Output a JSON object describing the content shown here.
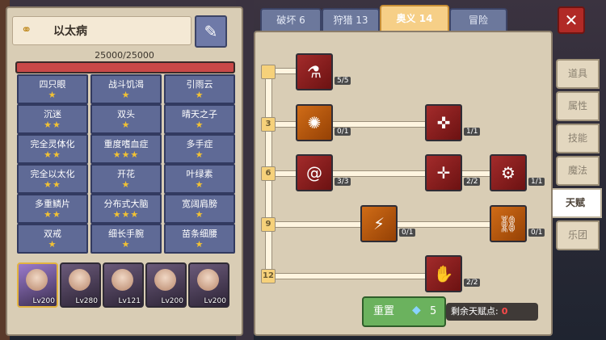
{
  "colors": {
    "accent": "#f6cf87",
    "hp": "#c94848",
    "cell": "#5f6a96"
  },
  "patient": {
    "name": "以太病",
    "icon": "link-chain-icon",
    "hp_text": "25000/25000",
    "hp_fraction": 1.0
  },
  "treatments": [
    {
      "label": "四只眼",
      "stars": "★"
    },
    {
      "label": "战斗饥渴",
      "stars": "★"
    },
    {
      "label": "引雨云",
      "stars": "★"
    },
    {
      "label": "沉迷",
      "stars": "★★"
    },
    {
      "label": "双头",
      "stars": "★"
    },
    {
      "label": "晴天之子",
      "stars": "★"
    },
    {
      "label": "完全灵体化",
      "stars": "★★"
    },
    {
      "label": "重度嗜血症",
      "stars": "★★★"
    },
    {
      "label": "多手症",
      "stars": "★"
    },
    {
      "label": "完全以太化",
      "stars": "★★"
    },
    {
      "label": "开花",
      "stars": "★"
    },
    {
      "label": "叶绿素",
      "stars": "★"
    },
    {
      "label": "多重鳞片",
      "stars": "★★"
    },
    {
      "label": "分布式大脑",
      "stars": "★★★"
    },
    {
      "label": "宽阔肩膀",
      "stars": "★"
    },
    {
      "label": "双戒",
      "stars": "★"
    },
    {
      "label": "细长手腕",
      "stars": "★"
    },
    {
      "label": "苗条细腰",
      "stars": "★"
    }
  ],
  "party": [
    {
      "level": "Lv200",
      "selected": true
    },
    {
      "level": "Lv280",
      "selected": false
    },
    {
      "level": "Lv121",
      "selected": false
    },
    {
      "level": "Lv200",
      "selected": false
    },
    {
      "level": "Lv200",
      "selected": false
    }
  ],
  "tabs": [
    {
      "label": "破坏 6"
    },
    {
      "label": "狩猎 13"
    },
    {
      "label": "奥义 14"
    },
    {
      "label": "冒险"
    }
  ],
  "side_tabs": [
    {
      "label": "道具"
    },
    {
      "label": "属性"
    },
    {
      "label": "技能"
    },
    {
      "label": "魔法"
    },
    {
      "label": "天赋"
    },
    {
      "label": "乐团"
    }
  ],
  "tree": {
    "levels": [
      "3",
      "6",
      "9",
      "12"
    ],
    "skills": [
      {
        "count": "5/5",
        "icon": "mp-icon"
      },
      {
        "count": "0/1",
        "icon": "vortex-icon"
      },
      {
        "count": "1/1",
        "icon": "hand-cross-icon"
      },
      {
        "count": "3/3",
        "icon": "spiral-icon"
      },
      {
        "count": "2/2",
        "icon": "crosshair-icon"
      },
      {
        "count": "1/1",
        "icon": "gear-icon"
      },
      {
        "count": "0/1",
        "icon": "claw-icon"
      },
      {
        "count": "0/1",
        "icon": "chain-icon"
      },
      {
        "count": "2/2",
        "icon": "palm-icon"
      }
    ]
  },
  "reset": {
    "label": "重置",
    "gem_count": "5"
  },
  "remaining": {
    "label": "剩余天赋点:",
    "value": "0"
  }
}
